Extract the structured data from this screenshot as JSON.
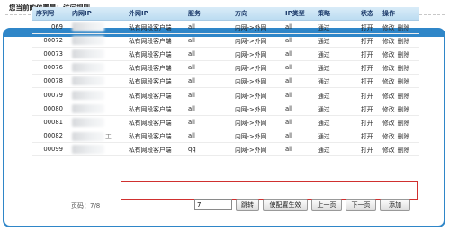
{
  "breadcrumb": {
    "prefix": "您当前的位置是：",
    "current": "访问规则"
  },
  "table": {
    "headers": [
      "序列号",
      "内网IP",
      "外网IP",
      "服务",
      "方向",
      "IP类型",
      "策略",
      "状态",
      "操作"
    ],
    "rows": [
      {
        "seq": "069",
        "inner_suffix": "",
        "outer": "私有网段客户端",
        "service": "all",
        "direction": "内网->外网",
        "ip_type": "all",
        "policy": "通过",
        "status": "打开",
        "edit": "修改",
        "delete": "删除"
      },
      {
        "seq": "00072",
        "inner_suffix": "",
        "outer": "私有网段客户端",
        "service": "all",
        "direction": "内网->外网",
        "ip_type": "all",
        "policy": "通过",
        "status": "打开",
        "edit": "修改",
        "delete": "删除"
      },
      {
        "seq": "00073",
        "inner_suffix": "",
        "outer": "私有网段客户端",
        "service": "all",
        "direction": "内网->外网",
        "ip_type": "all",
        "policy": "通过",
        "status": "打开",
        "edit": "修改",
        "delete": "删除"
      },
      {
        "seq": "00076",
        "inner_suffix": "",
        "outer": "私有网段客户端",
        "service": "all",
        "direction": "内网->外网",
        "ip_type": "all",
        "policy": "通过",
        "status": "打开",
        "edit": "修改",
        "delete": "删除"
      },
      {
        "seq": "00078",
        "inner_suffix": "",
        "outer": "私有网段客户端",
        "service": "all",
        "direction": "内网->外网",
        "ip_type": "all",
        "policy": "通过",
        "status": "打开",
        "edit": "修改",
        "delete": "删除"
      },
      {
        "seq": "00079",
        "inner_suffix": "",
        "outer": "私有网段客户端",
        "service": "all",
        "direction": "内网->外网",
        "ip_type": "all",
        "policy": "通过",
        "status": "打开",
        "edit": "修改",
        "delete": "删除"
      },
      {
        "seq": "00080",
        "inner_suffix": "",
        "outer": "私有网段客户端",
        "service": "all",
        "direction": "内网->外网",
        "ip_type": "all",
        "policy": "通过",
        "status": "打开",
        "edit": "修改",
        "delete": "删除"
      },
      {
        "seq": "00081",
        "inner_suffix": "",
        "outer": "私有网段客户端",
        "service": "all",
        "direction": "内网->外网",
        "ip_type": "all",
        "policy": "通过",
        "status": "打开",
        "edit": "修改",
        "delete": "删除"
      },
      {
        "seq": "00082",
        "inner_suffix": "工",
        "outer": "私有网段客户端",
        "service": "all",
        "direction": "内网->外网",
        "ip_type": "all",
        "policy": "通过",
        "status": "打开",
        "edit": "修改",
        "delete": "删除"
      },
      {
        "seq": "00099",
        "inner_suffix": "",
        "outer": "私有网段客户端",
        "service": "qq",
        "direction": "内网->外网",
        "ip_type": "all",
        "policy": "通过",
        "status": "打开",
        "edit": "修改",
        "delete": "删除"
      }
    ]
  },
  "pager": {
    "label": "页码：7/8",
    "page_value": "7",
    "jump_label": "跳转",
    "apply_label": "使配置生效",
    "prev_label": "上一页",
    "next_label": "下一页",
    "add_label": "添加"
  },
  "colors": {
    "panel_blue": "#2f86c8",
    "highlight_red": "#d0302f"
  }
}
